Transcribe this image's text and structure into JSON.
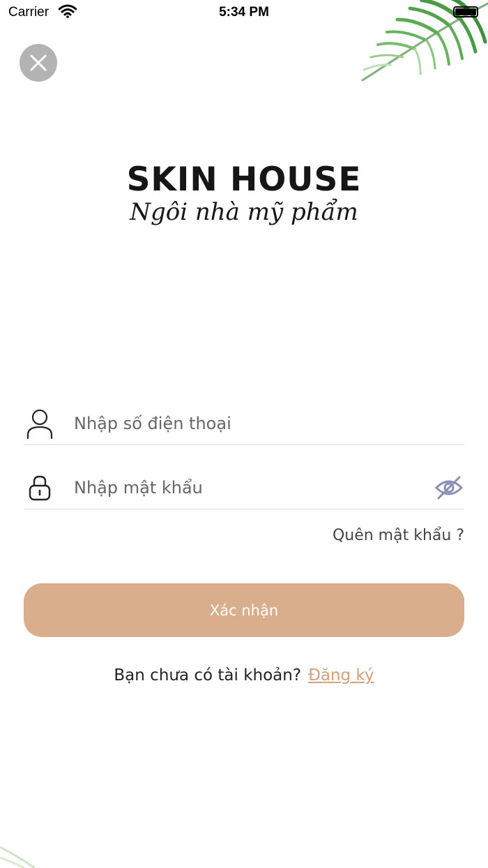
{
  "status_bar": {
    "carrier": "Carrier",
    "time": "5:34 PM"
  },
  "logo": {
    "title": "SKIN HOUSE",
    "subtitle": "Ngôi nhà mỹ phẩm"
  },
  "form": {
    "phone_placeholder": "Nhập số điện thoại",
    "password_placeholder": "Nhập mật khẩu",
    "forgot_password": "Quên mật khẩu ?",
    "submit_label": "Xác nhận"
  },
  "signup": {
    "prompt": "Bạn chưa có tài khoản?",
    "link": "Đăng ký"
  },
  "colors": {
    "accent": "#d8ae8c",
    "link": "#d4a07b",
    "close_button": "#b3b3b3",
    "eye_icon": "#8a8fb8"
  },
  "icons": [
    "wifi-icon",
    "battery-icon",
    "close-icon",
    "user-icon",
    "lock-icon",
    "eye-off-icon",
    "palm-leaf"
  ]
}
